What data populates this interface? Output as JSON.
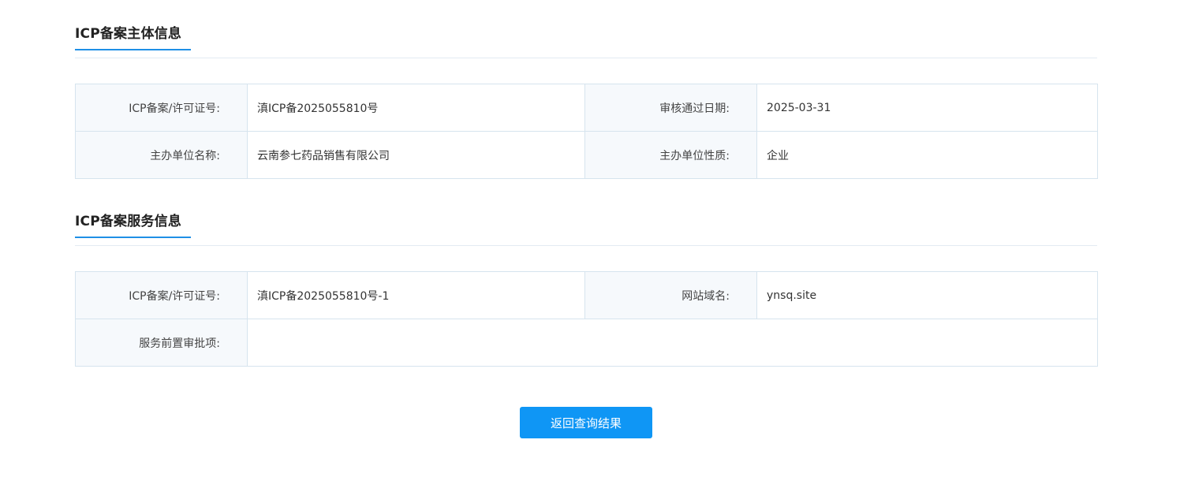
{
  "subject_section": {
    "title": "ICP备案主体信息",
    "rows": [
      {
        "label1": "ICP备案/许可证号:",
        "value1": "滇ICP备2025055810号",
        "label2": "审核通过日期:",
        "value2": "2025-03-31"
      },
      {
        "label1": "主办单位名称:",
        "value1": "云南参七药品销售有限公司",
        "label2": "主办单位性质:",
        "value2": "企业"
      }
    ]
  },
  "service_section": {
    "title": "ICP备案服务信息",
    "license_label": "ICP备案/许可证号:",
    "license_value": "滇ICP备2025055810号-1",
    "domain_label": "网站域名:",
    "domain_value": "ynsq.site",
    "preapproval_label": "服务前置审批项:",
    "preapproval_value": ""
  },
  "return_button_label": "返回查询结果",
  "colors": {
    "accent": "#1e8fe6",
    "button": "#0f96f5",
    "label_bg": "#f6f9fc",
    "border": "#d6e4ee"
  }
}
